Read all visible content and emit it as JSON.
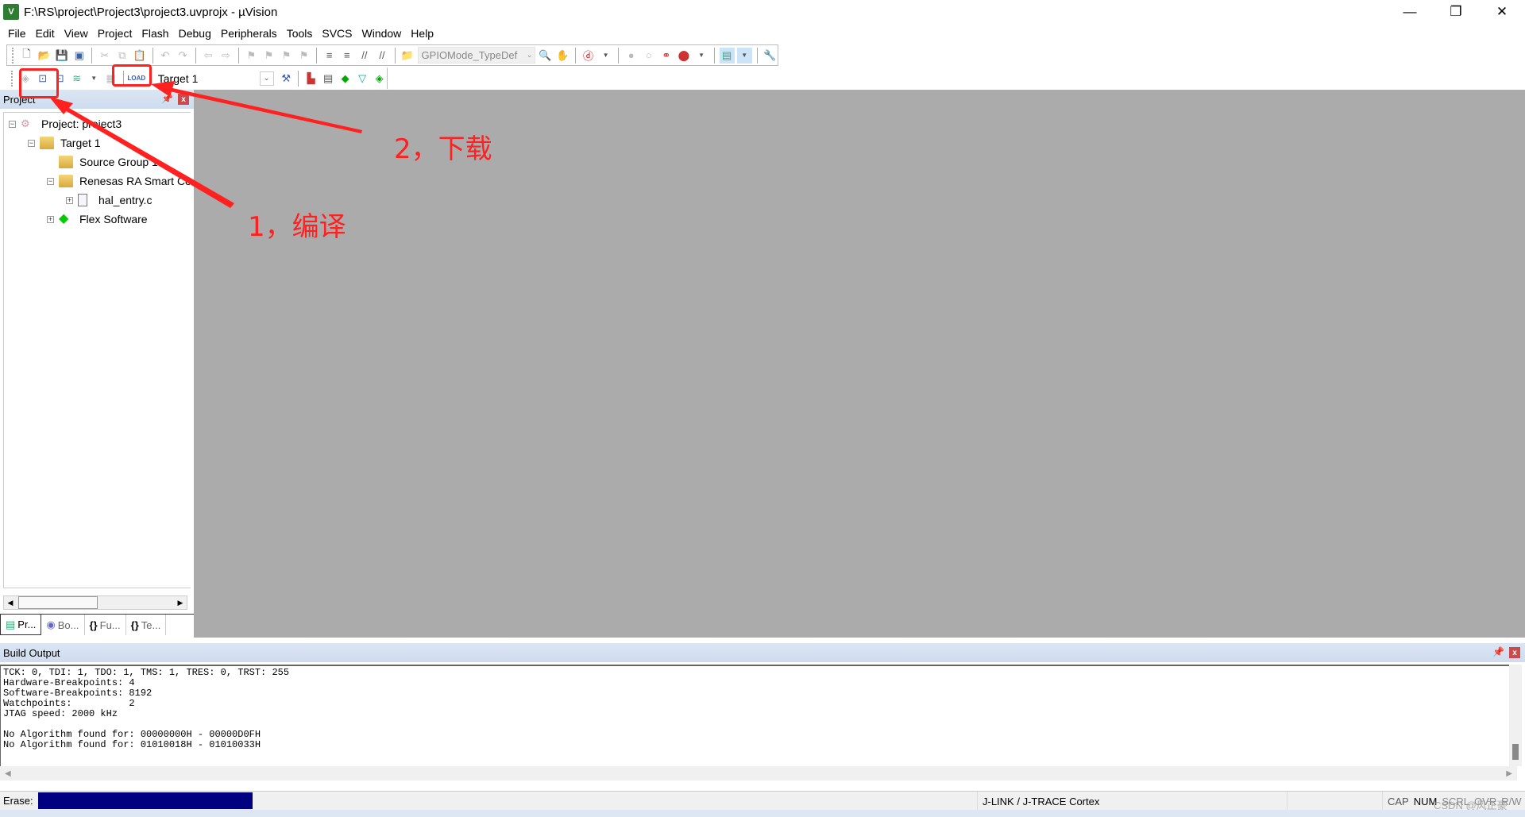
{
  "window": {
    "title": "F:\\RS\\project\\Project3\\project3.uvprojx - µVision",
    "app_icon": "uvision-icon",
    "controls": {
      "minimize": "—",
      "restore": "❐",
      "close": "✕"
    }
  },
  "menu": [
    "File",
    "Edit",
    "View",
    "Project",
    "Flash",
    "Debug",
    "Peripherals",
    "Tools",
    "SVCS",
    "Window",
    "Help"
  ],
  "toolbar": {
    "find_combo_value": "GPIOMode_TypeDef",
    "target_combo_value": "Target 1"
  },
  "project_panel": {
    "title": "Project",
    "tree": [
      {
        "label": "Project: project3",
        "expander": "⊟"
      },
      {
        "label": "Target 1",
        "expander": "⊟"
      },
      {
        "label": "Source Group 1",
        "expander": ""
      },
      {
        "label": "Renesas RA Smart Co",
        "expander": "⊟"
      },
      {
        "label": "hal_entry.c",
        "expander": "⊞"
      },
      {
        "label": "Flex Software",
        "expander": "⊞"
      }
    ],
    "tabs": [
      "Pr...",
      "Bo...",
      "Fu...",
      "Te..."
    ]
  },
  "build_output": {
    "title": "Build Output",
    "lines": [
      "TCK: 0, TDI: 1, TDO: 1, TMS: 1, TRES: 0, TRST: 255",
      "Hardware-Breakpoints: 4",
      "Software-Breakpoints: 8192",
      "Watchpoints:          2",
      "JTAG speed: 2000 kHz",
      "",
      "No Algorithm found for: 00000000H - 00000D0FH",
      "No Algorithm found for: 01010018H - 01010033H"
    ]
  },
  "statusbar": {
    "erase_label": "Erase:",
    "erase_progress_percent": 100,
    "debugger": "J-LINK / J-TRACE Cortex",
    "indicators": [
      "CAP",
      "NUM",
      "SCRL",
      "OVR",
      "R/W"
    ],
    "watermark": "CSDN @风正豪"
  },
  "annotations": {
    "step1": "1，编译",
    "step2": "2，下载",
    "color": "#ff2020"
  }
}
